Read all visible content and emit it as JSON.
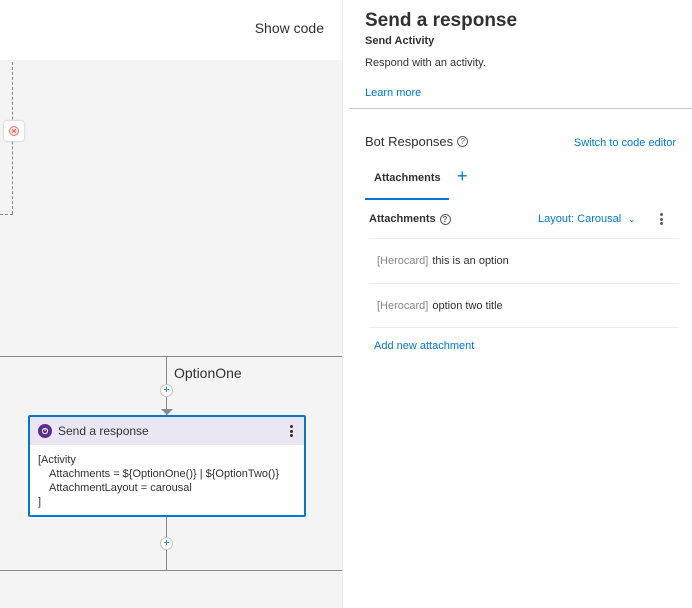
{
  "toolbar": {
    "show_code_label": "Show code"
  },
  "canvas": {
    "branch_label": "OptionOne",
    "node": {
      "title": "Send a response",
      "icon": "chat-bubble-icon",
      "lines": [
        "[Activity",
        "Attachments = ${OptionOne()} | ${OptionTwo()}",
        "AttachmentLayout = carousal",
        "]"
      ]
    }
  },
  "panel": {
    "title": "Send a response",
    "subtitle": "Send Activity",
    "description": "Respond with an activity.",
    "learn_more": "Learn more",
    "bot_responses_label": "Bot Responses",
    "switch_editor": "Switch to code editor",
    "tab_attachments": "Attachments",
    "attachments_header": "Attachments",
    "layout_dropdown": "Layout: Carousal",
    "attachments": [
      {
        "tag": "[Herocard]",
        "text": "this is an option"
      },
      {
        "tag": "[Herocard]",
        "text": "option two title"
      }
    ],
    "add_attachment": "Add new attachment"
  },
  "colors": {
    "accent": "#0078d4",
    "node_purple": "#5c2d91",
    "node_header": "#eae6f3",
    "error": "#d9534f"
  }
}
